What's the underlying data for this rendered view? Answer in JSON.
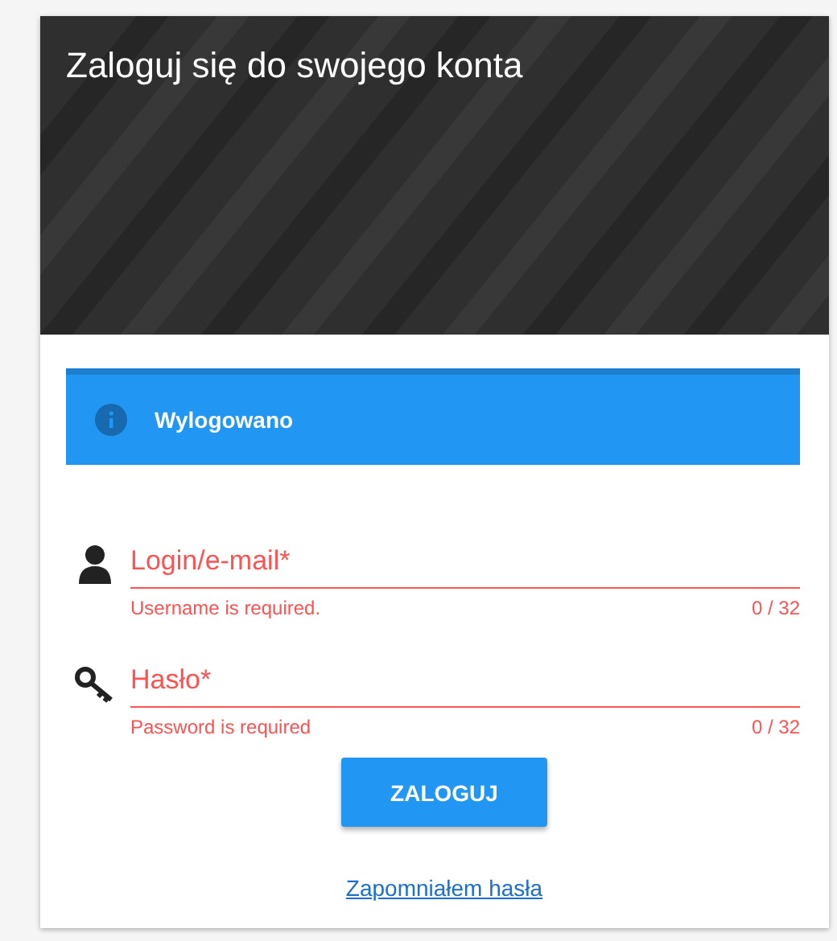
{
  "header": {
    "title": "Zaloguj się do swojego konta"
  },
  "alert": {
    "message": "Wylogowano"
  },
  "fields": [
    {
      "kind": "user",
      "placeholder": "Login/e-mail*",
      "error": true,
      "hint": "Username is required.",
      "counter": "0 / 32"
    },
    {
      "kind": "password",
      "placeholder": "Hasło*",
      "error": true,
      "hint": "Password is required",
      "counter": "0 / 32"
    }
  ],
  "submit": "ZALOGUJ",
  "forgot_link": "Zapomniałem hasła"
}
